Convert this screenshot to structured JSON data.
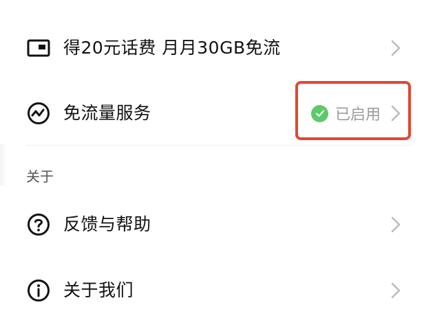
{
  "rows": {
    "data_bonus": {
      "label": "得20元话费 月月30GB免流",
      "icon": "sim-card-icon"
    },
    "free_data_service": {
      "label": "免流量服务",
      "icon": "activity-circle-icon",
      "status_text": "已启用",
      "status_icon": "check-circle-icon"
    },
    "feedback_help": {
      "label": "反馈与帮助",
      "icon": "question-circle-icon"
    },
    "about_us": {
      "label": "关于我们",
      "icon": "info-circle-icon"
    }
  },
  "section": {
    "about_title": "关于"
  },
  "colors": {
    "success_green": "#5cc96a",
    "highlight_red": "#e4462f",
    "chevron_gray": "#bbbbbb",
    "secondary_text": "#9a9a9a"
  }
}
